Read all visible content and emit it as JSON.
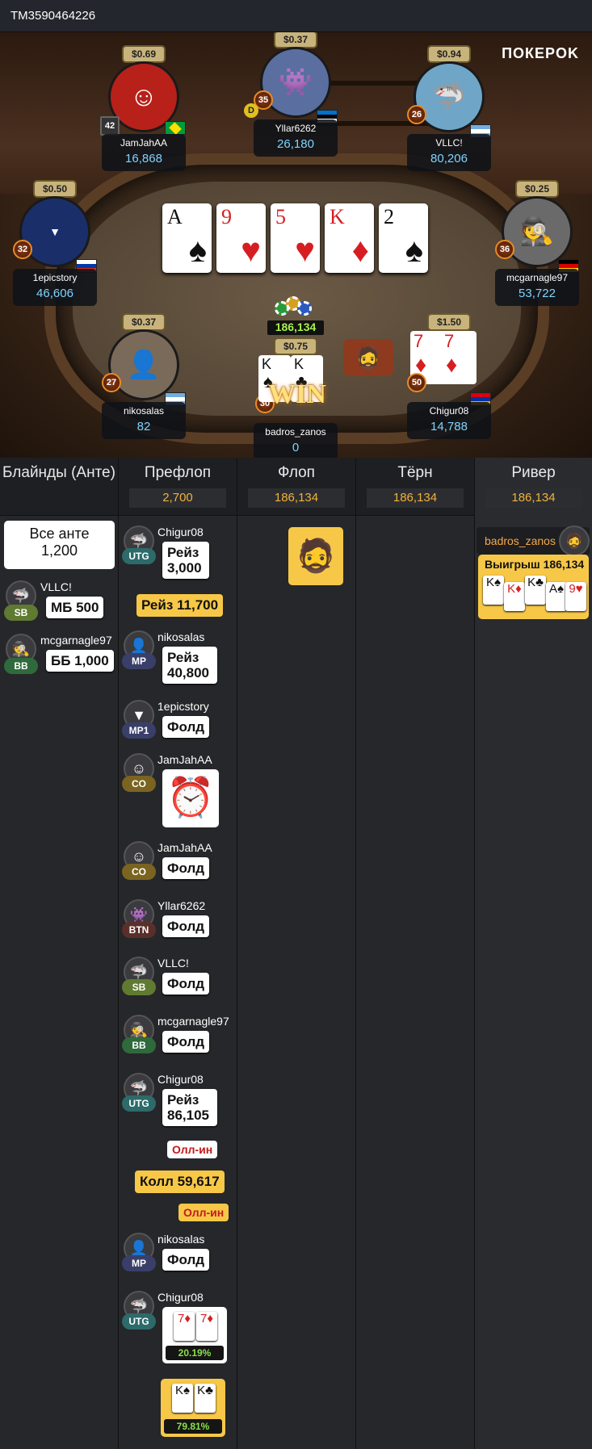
{
  "hand_id": "TM3590464226",
  "brand": "ПОКЕРOK",
  "table": {
    "pot": "186,134",
    "win_text": "WIN",
    "board": [
      {
        "rank": "A",
        "suit": "♠",
        "color": "blk"
      },
      {
        "rank": "9",
        "suit": "♥",
        "color": "red"
      },
      {
        "rank": "5",
        "suit": "♥",
        "color": "red"
      },
      {
        "rank": "K",
        "suit": "♦",
        "color": "red"
      },
      {
        "rank": "2",
        "suit": "♠",
        "color": "blk"
      }
    ],
    "hero_cards": [
      {
        "rank": "K",
        "suit": "♠"
      },
      {
        "rank": "K",
        "suit": "♣"
      }
    ],
    "seats": [
      {
        "name": "JamJahAA",
        "stack": "16,868",
        "bet": "$0.69",
        "level": "42",
        "flag": "Brazil",
        "avatar_icon": "daruma-icon"
      },
      {
        "name": "Yllar6262",
        "stack": "26,180",
        "bet": "$0.37",
        "level": "35",
        "flag": "Estonia",
        "avatar_icon": "monster-icon"
      },
      {
        "name": "VLLC!",
        "stack": "80,206",
        "bet": "$0.94",
        "level": "26",
        "flag": "Argentina",
        "avatar_icon": "shark-icon"
      },
      {
        "name": "1epicstory",
        "stack": "46,606",
        "bet": "$0.50",
        "level": "32",
        "flag": "Russia",
        "avatar_icon": "lucky-you-icon"
      },
      {
        "name": "mcgarnagle97",
        "stack": "53,722",
        "bet": "$0.25",
        "level": "36",
        "flag": "Germany",
        "avatar_icon": "mobster-icon"
      },
      {
        "name": "nikosalas",
        "stack": "82",
        "bet": "$0.37",
        "level": "27",
        "flag": "Argentina",
        "avatar_icon": "man-photo-icon"
      },
      {
        "name": "badros_zanos",
        "stack": "0",
        "bet": "$0.75",
        "level": "30",
        "flag": "",
        "avatar_icon": "hero-icon"
      },
      {
        "name": "Chigur08",
        "stack": "14,788",
        "bet": "$1.50",
        "level": "50",
        "flag": "Armenia",
        "avatar_icon": "shark-icon",
        "shown": [
          {
            "rank": "7",
            "suit": "♦"
          },
          {
            "rank": "7",
            "suit": "♦"
          }
        ]
      }
    ]
  },
  "history": {
    "columns": [
      {
        "title": "Блайнды (Анте)",
        "pot": ""
      },
      {
        "title": "Префлоп",
        "pot": "2,700"
      },
      {
        "title": "Флоп",
        "pot": "186,134"
      },
      {
        "title": "Тёрн",
        "pot": "186,134"
      },
      {
        "title": "Ривер",
        "pot": "186,134"
      }
    ],
    "blinds": {
      "ante_label": "Все анте",
      "ante_value": "1,200",
      "sb": {
        "name": "VLLC!",
        "pos": "SB",
        "action": "МБ 500"
      },
      "bb": {
        "name": "mcgarnagle97",
        "pos": "BB",
        "action": "ББ 1,000"
      }
    },
    "preflop": [
      {
        "name": "Chigur08",
        "pos": "UTG",
        "action": "Рейз 3,000"
      },
      {
        "hero": true,
        "action": "Рейз 11,700"
      },
      {
        "name": "nikosalas",
        "pos": "MP",
        "action": "Рейз 40,800"
      },
      {
        "name": "1epicstory",
        "pos": "MP1",
        "action": "Фолд"
      },
      {
        "name": "JamJahAA",
        "pos": "CO",
        "action": "alarm-clock"
      },
      {
        "name": "JamJahAA",
        "pos": "CO",
        "action": "Фолд"
      },
      {
        "name": "Yllar6262",
        "pos": "BTN",
        "action": "Фолд"
      },
      {
        "name": "VLLC!",
        "pos": "SB",
        "action": "Фолд"
      },
      {
        "name": "mcgarnagle97",
        "pos": "BB",
        "action": "Фолд"
      },
      {
        "name": "Chigur08",
        "pos": "UTG",
        "action": "Рейз 86,105",
        "tag": "Олл-ин"
      },
      {
        "hero": true,
        "action": "Колл 59,617",
        "tag": "Олл-ин"
      },
      {
        "name": "nikosalas",
        "pos": "MP",
        "action": "Фолд"
      },
      {
        "name": "Chigur08",
        "pos": "UTG",
        "cards": [
          "7♦",
          "7♦"
        ],
        "equity": "20.19%"
      },
      {
        "hero": true,
        "cards": [
          "K♠",
          "K♣"
        ],
        "equity": "79.81%"
      }
    ],
    "river": {
      "winner": "badros_zanos",
      "win_label": "Выигрыш 186,134",
      "hand": [
        "K♠",
        "K♦",
        "K♣",
        "A♠",
        "9♥"
      ]
    }
  }
}
